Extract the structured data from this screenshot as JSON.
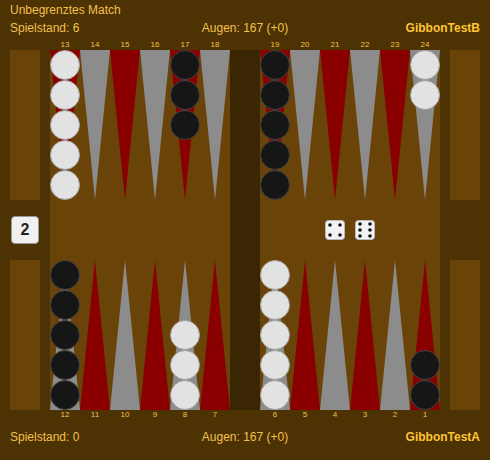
{
  "match_title": "Unbegrenztes Match",
  "top_player": {
    "score": "Spielstand: 6",
    "pips": "Augen: 167 (+0)",
    "name": "GibbonTestB"
  },
  "bottom_player": {
    "score": "Spielstand: 0",
    "pips": "Augen: 167 (+0)",
    "name": "GibbonTestA"
  },
  "cube": "2",
  "dice": [
    {
      "value": 4
    },
    {
      "value": 6
    }
  ],
  "board": {
    "top_left": [
      {
        "label": "13",
        "color": "#8a0000",
        "checkers": 5,
        "player": "white"
      },
      {
        "label": "14",
        "color": "#8c8c8c",
        "checkers": 0,
        "player": "none"
      },
      {
        "label": "15",
        "color": "#8a0000",
        "checkers": 0,
        "player": "none"
      },
      {
        "label": "16",
        "color": "#8c8c8c",
        "checkers": 0,
        "player": "none"
      },
      {
        "label": "17",
        "color": "#8a0000",
        "checkers": 3,
        "player": "black"
      },
      {
        "label": "18",
        "color": "#8c8c8c",
        "checkers": 0,
        "player": "none"
      }
    ],
    "top_right": [
      {
        "label": "19",
        "color": "#8a0000",
        "checkers": 5,
        "player": "black"
      },
      {
        "label": "20",
        "color": "#8c8c8c",
        "checkers": 0,
        "player": "none"
      },
      {
        "label": "21",
        "color": "#8a0000",
        "checkers": 0,
        "player": "none"
      },
      {
        "label": "22",
        "color": "#8c8c8c",
        "checkers": 0,
        "player": "none"
      },
      {
        "label": "23",
        "color": "#8a0000",
        "checkers": 0,
        "player": "none"
      },
      {
        "label": "24",
        "color": "#8c8c8c",
        "checkers": 2,
        "player": "white"
      }
    ],
    "bottom_left": [
      {
        "label": "12",
        "color": "#8c8c8c",
        "checkers": 5,
        "player": "black"
      },
      {
        "label": "11",
        "color": "#8a0000",
        "checkers": 0,
        "player": "none"
      },
      {
        "label": "10",
        "color": "#8c8c8c",
        "checkers": 0,
        "player": "none"
      },
      {
        "label": "9",
        "color": "#8a0000",
        "checkers": 0,
        "player": "none"
      },
      {
        "label": "8",
        "color": "#8c8c8c",
        "checkers": 3,
        "player": "white"
      },
      {
        "label": "7",
        "color": "#8a0000",
        "checkers": 0,
        "player": "none"
      }
    ],
    "bottom_right": [
      {
        "label": "6",
        "color": "#8c8c8c",
        "checkers": 5,
        "player": "white"
      },
      {
        "label": "5",
        "color": "#8a0000",
        "checkers": 0,
        "player": "none"
      },
      {
        "label": "4",
        "color": "#8c8c8c",
        "checkers": 0,
        "player": "none"
      },
      {
        "label": "3",
        "color": "#8a0000",
        "checkers": 0,
        "player": "none"
      },
      {
        "label": "2",
        "color": "#8c8c8c",
        "checkers": 0,
        "player": "none"
      },
      {
        "label": "1",
        "color": "#8a0000",
        "checkers": 2,
        "player": "black"
      }
    ]
  }
}
